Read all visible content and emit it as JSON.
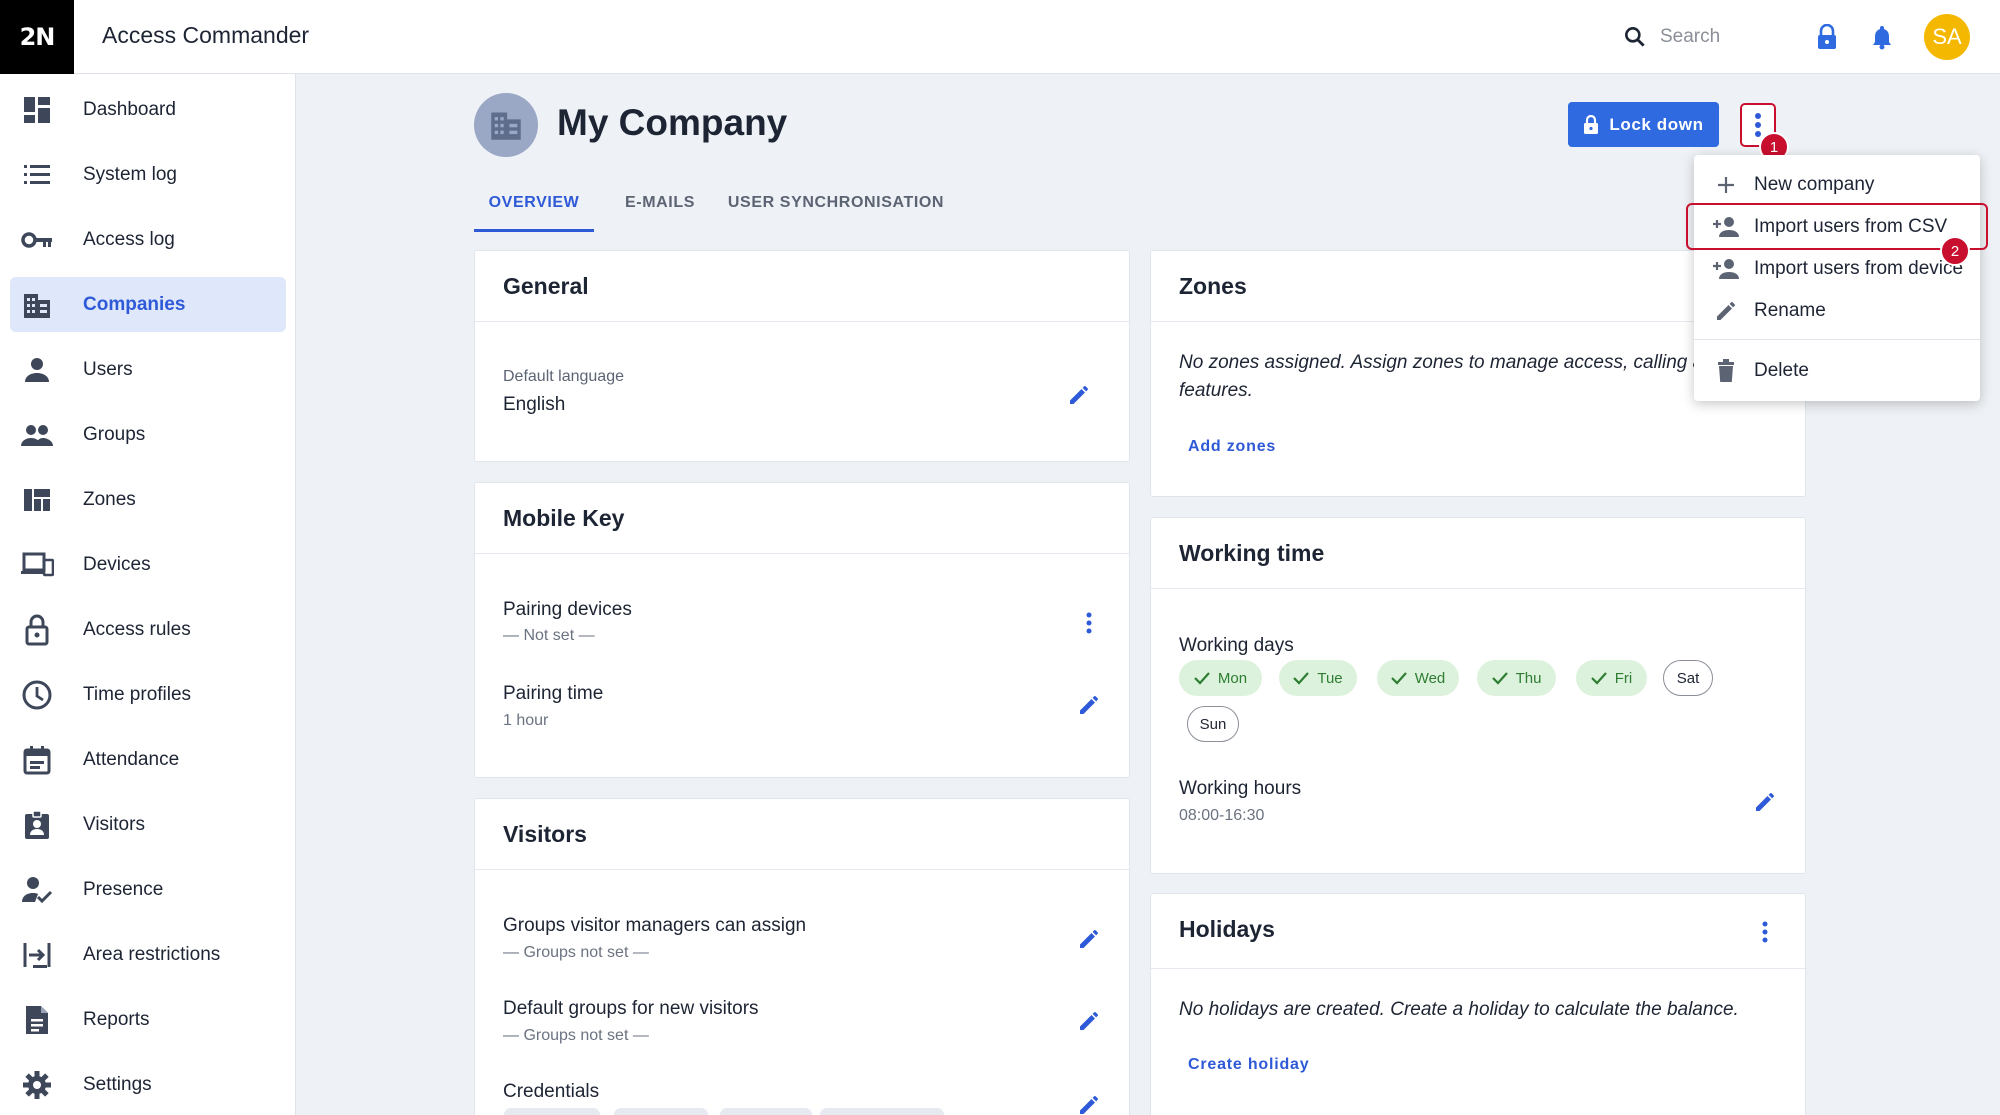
{
  "app": {
    "logo": "2N",
    "title": "Access Commander"
  },
  "topbar": {
    "search_placeholder": "Search",
    "avatar_initials": "SA"
  },
  "sidebar": {
    "items": [
      {
        "label": "Dashboard",
        "icon": "dashboard-icon"
      },
      {
        "label": "System log",
        "icon": "list-icon"
      },
      {
        "label": "Access log",
        "icon": "key-icon"
      },
      {
        "label": "Companies",
        "icon": "building-icon",
        "active": true
      },
      {
        "label": "Users",
        "icon": "person-icon"
      },
      {
        "label": "Groups",
        "icon": "people-icon"
      },
      {
        "label": "Zones",
        "icon": "zones-icon"
      },
      {
        "label": "Devices",
        "icon": "devices-icon"
      },
      {
        "label": "Access rules",
        "icon": "lock-icon"
      },
      {
        "label": "Time profiles",
        "icon": "clock-icon"
      },
      {
        "label": "Attendance",
        "icon": "calendar-icon"
      },
      {
        "label": "Visitors",
        "icon": "badge-icon"
      },
      {
        "label": "Presence",
        "icon": "person-check-icon"
      },
      {
        "label": "Area restrictions",
        "icon": "area-icon"
      },
      {
        "label": "Reports",
        "icon": "document-icon"
      },
      {
        "label": "Settings",
        "icon": "gear-icon"
      }
    ]
  },
  "header": {
    "title": "My Company",
    "lock_down_label": "Lock down",
    "step1": "1",
    "step2": "2"
  },
  "tabs": [
    "OVERVIEW",
    "E-MAILS",
    "USER SYNCHRONISATION"
  ],
  "general": {
    "title": "General",
    "language_label": "Default language",
    "language_value": "English"
  },
  "mobile_key": {
    "title": "Mobile Key",
    "pairing_devices_label": "Pairing devices",
    "pairing_devices_value": "— Not set —",
    "pairing_time_label": "Pairing time",
    "pairing_time_value": "1 hour"
  },
  "visitors": {
    "title": "Visitors",
    "groups_assign_label": "Groups visitor managers can assign",
    "groups_assign_value": "— Groups not set —",
    "default_groups_label": "Default groups for new visitors",
    "default_groups_value": "— Groups not set —",
    "credentials_label": "Credentials"
  },
  "zones": {
    "title": "Zones",
    "empty_text_line1": "No zones assigned. Assign zones to manage access, calling an",
    "empty_text_line2": "features.",
    "add_label": "Add zones"
  },
  "working_time": {
    "title": "Working time",
    "days_label": "Working days",
    "days": [
      {
        "label": "Mon",
        "on": true
      },
      {
        "label": "Tue",
        "on": true
      },
      {
        "label": "Wed",
        "on": true
      },
      {
        "label": "Thu",
        "on": true
      },
      {
        "label": "Fri",
        "on": true
      },
      {
        "label": "Sat",
        "on": false
      },
      {
        "label": "Sun",
        "on": false
      }
    ],
    "hours_label": "Working hours",
    "hours_value": "08:00-16:30"
  },
  "holidays": {
    "title": "Holidays",
    "empty_text": "No holidays are created. Create a holiday to calculate the balance.",
    "create_label": "Create holiday"
  },
  "menu": {
    "items": [
      {
        "label": "New company",
        "icon": "plus-icon"
      },
      {
        "label": "Import users from CSV",
        "icon": "person-add-icon"
      },
      {
        "label": "Import users from device",
        "icon": "person-add-icon"
      },
      {
        "label": "Rename",
        "icon": "pencil-icon"
      },
      {
        "label": "Delete",
        "icon": "trash-icon"
      }
    ]
  },
  "colors": {
    "accent": "#2f5ad7",
    "button": "#2f6ae0",
    "highlight": "#c8102e",
    "chip_on": "#dcf2dc"
  }
}
